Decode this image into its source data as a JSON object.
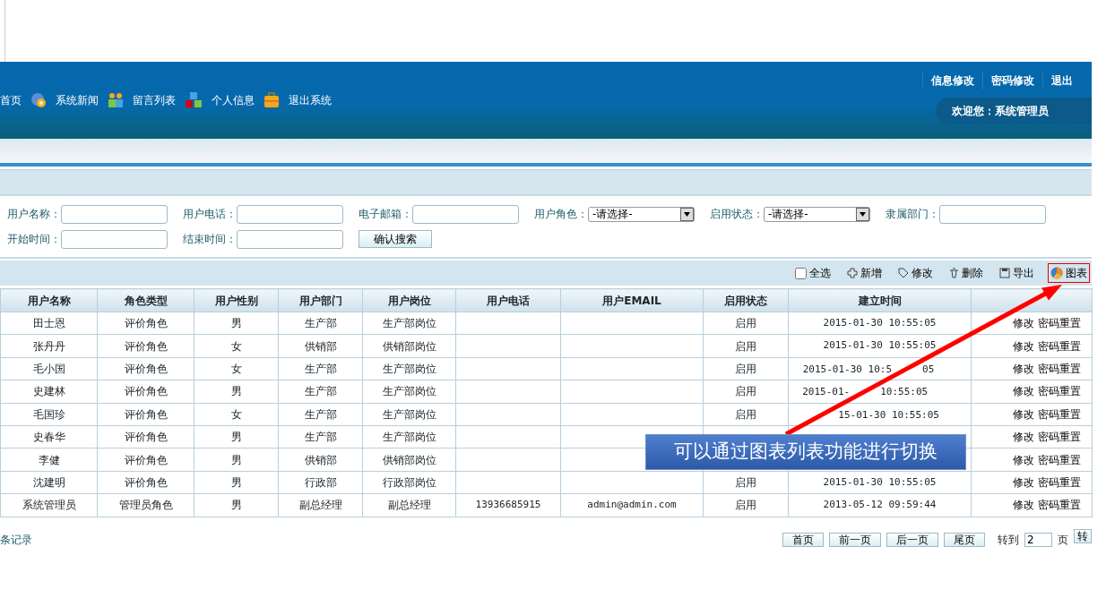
{
  "header": {
    "nav": [
      {
        "label": "首页"
      },
      {
        "label": "系统新闻"
      },
      {
        "label": "留言列表"
      },
      {
        "label": "个人信息"
      },
      {
        "label": "退出系统"
      }
    ],
    "top_links": [
      "信息修改",
      "密码修改",
      "退出"
    ],
    "welcome": "欢迎您：系统管理员"
  },
  "search": {
    "fields": [
      {
        "label": "用户名称：",
        "kind": "text"
      },
      {
        "label": "用户电话：",
        "kind": "text"
      },
      {
        "label": "电子邮箱：",
        "kind": "text"
      },
      {
        "label": "用户角色：",
        "kind": "select",
        "value": "-请选择-"
      },
      {
        "label": "启用状态：",
        "kind": "select",
        "value": "-请选择-"
      },
      {
        "label": "隶属部门：",
        "kind": "text"
      },
      {
        "label": "开始时间：",
        "kind": "text"
      },
      {
        "label": "结束时间：",
        "kind": "text"
      }
    ],
    "button": "确认搜索"
  },
  "toolbar": {
    "select_all": {
      "label": "全选",
      "checked": false
    },
    "actions": [
      {
        "label": "新增",
        "highlighted": false
      },
      {
        "label": "修改",
        "highlighted": false
      },
      {
        "label": "删除",
        "highlighted": false
      },
      {
        "label": "导出",
        "highlighted": false
      },
      {
        "label": "图表",
        "highlighted": true
      }
    ]
  },
  "table": {
    "columns": [
      "用户名称",
      "角色类型",
      "用户性别",
      "用户部门",
      "用户岗位",
      "用户电话",
      "用户EMAIL",
      "启用状态",
      "建立时间"
    ],
    "rows": [
      {
        "cells": [
          "田士恩",
          "评价角色",
          "男",
          "生产部",
          "生产部岗位",
          null,
          null,
          "启用",
          "2015-01-30 10:55:05"
        ],
        "actions": [
          "修改",
          "密码重置"
        ]
      },
      {
        "cells": [
          "张丹丹",
          "评价角色",
          "女",
          "供销部",
          "供销部岗位",
          null,
          null,
          "启用",
          "2015-01-30 10:55:05"
        ],
        "actions": [
          "修改",
          "密码重置"
        ]
      },
      {
        "cells": [
          "毛小国",
          "评价角色",
          "女",
          "生产部",
          "生产部岗位",
          null,
          null,
          "启用",
          [
            "2015-01-30 10:5",
            "05"
          ]
        ],
        "actions": [
          "修改",
          "密码重置"
        ]
      },
      {
        "cells": [
          "史建林",
          "评价角色",
          "男",
          "生产部",
          "生产部岗位",
          null,
          null,
          "启用",
          [
            "2015-01-",
            "10:55:05"
          ]
        ],
        "actions": [
          "修改",
          "密码重置"
        ]
      },
      {
        "cells": [
          "毛国珍",
          "评价角色",
          "女",
          "生产部",
          "生产部岗位",
          null,
          null,
          "启用",
          [
            "15-01-30 10:55:05"
          ]
        ],
        "actions": [
          "修改",
          "密码重置"
        ]
      },
      {
        "cells": [
          "史春华",
          "评价角色",
          "男",
          "生产部",
          "生产部岗位",
          null,
          null,
          null,
          null
        ],
        "actions": [
          "修改",
          "密码重置"
        ]
      },
      {
        "cells": [
          "李健",
          "评价角色",
          "男",
          "供销部",
          "供销部岗位",
          null,
          null,
          null,
          null
        ],
        "actions": [
          "修改",
          "密码重置"
        ]
      },
      {
        "cells": [
          "沈建明",
          "评价角色",
          "男",
          "行政部",
          "行政部岗位",
          null,
          null,
          "启用",
          "2015-01-30 10:55:05"
        ],
        "actions": [
          "修改",
          "密码重置"
        ]
      },
      {
        "cells": [
          "系统管理员",
          "管理员角色",
          "男",
          "副总经理",
          "副总经理",
          "13936685915",
          "admin@admin.com",
          "启用",
          "2013-05-12 09:59:44"
        ],
        "actions": [
          "修改",
          "密码重置"
        ]
      }
    ]
  },
  "footer": {
    "summary": "条记录",
    "pager": [
      "首页",
      "前一页",
      "后一页",
      "尾页"
    ],
    "goto_label": "转到",
    "page_value": "2",
    "page_suffix": "页",
    "go_button": "转"
  },
  "annotation": {
    "text": "可以通过图表列表功能进行切换"
  }
}
